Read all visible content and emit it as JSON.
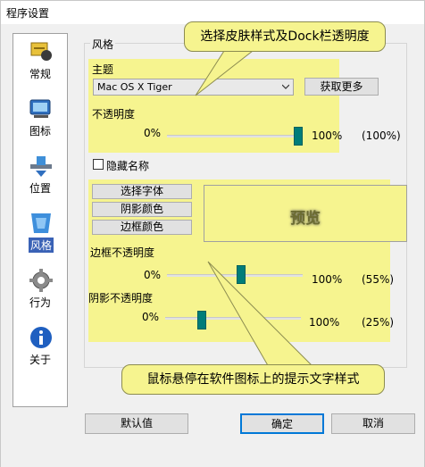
{
  "window": {
    "title": "程序设置"
  },
  "sidebar": {
    "items": [
      {
        "label": "常规",
        "icon": "general-settings-icon",
        "active": false
      },
      {
        "label": "图标",
        "icon": "monitor-icon",
        "active": false
      },
      {
        "label": "位置",
        "icon": "dock-position-icon",
        "active": false
      },
      {
        "label": "风格",
        "icon": "style-brush-icon",
        "active": true
      },
      {
        "label": "行为",
        "icon": "gear-icon",
        "active": false
      },
      {
        "label": "关于",
        "icon": "info-icon",
        "active": false
      }
    ]
  },
  "style_group": {
    "title": "风格",
    "theme_label": "主题",
    "theme_value": "Mac OS X Tiger",
    "get_more_label": "获取更多",
    "opacity_label": "不透明度",
    "opacity_min": "0%",
    "opacity_max": "100%",
    "opacity_value_text": "(100%)",
    "opacity_value": 100,
    "hide_name_label": "隐藏名称",
    "hide_name_checked": false,
    "choose_font_label": "选择字体",
    "shadow_color_label": "阴影颜色",
    "border_color_label": "边框颜色",
    "preview_label": "预览",
    "border_opacity_label": "边框不透明度",
    "border_opacity_min": "0%",
    "border_opacity_max": "100%",
    "border_opacity_value_text": "(55%)",
    "border_opacity_value": 55,
    "shadow_opacity_label": "阴影不透明度",
    "shadow_opacity_min": "0%",
    "shadow_opacity_max": "100%",
    "shadow_opacity_value_text": "(25%)",
    "shadow_opacity_value": 25
  },
  "callouts": {
    "top": "选择皮肤样式及Dock栏透明度",
    "bottom": "鼠标悬停在软件图标上的提示文字样式"
  },
  "footer": {
    "default_label": "默认值",
    "ok_label": "确定",
    "cancel_label": "取消"
  },
  "colors": {
    "highlight": "#f6f48f",
    "slider_thumb": "#007d79",
    "active_nav": "#3a62b6"
  }
}
